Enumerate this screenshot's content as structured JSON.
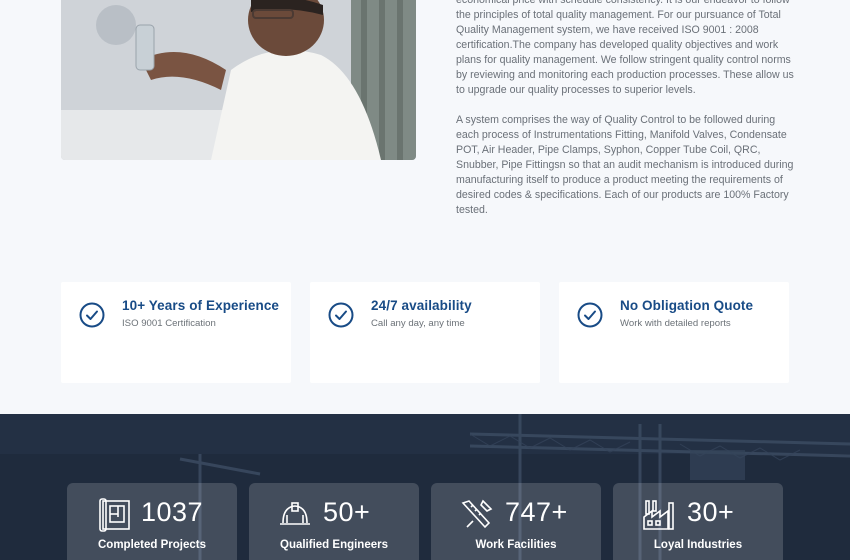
{
  "intro": {
    "paragraph1": "economical price with schedule consistency. It is our endeavor to follow the principles of total quality management. For our pursuance of Total Quality Management system, we have received ISO 9001 : 2008 certification.The company has developed quality objectives and work plans for quality management. We follow stringent quality control norms by reviewing and monitoring each production processes. These allow us to upgrade our quality processes to superior levels.",
    "paragraph2": "A system comprises the way of Quality Control to be followed during each process of Instrumentations Fitting, Manifold Valves, Condensate POT, Air Header, Pipe Clamps, Syphon, Copper Tube Coil, QRC, Snubber, Pipe Fittingsn so that an audit mechanism is introduced during manufacturing itself to produce a product meeting the requirements of desired codes & specifications. Each of our products are 100% Factory tested."
  },
  "features": [
    {
      "title": "10+ Years of Experience",
      "subtitle": "ISO 9001 Certification",
      "icon": "check-circle-icon"
    },
    {
      "title": "24/7 availability",
      "subtitle": "Call any day, any time",
      "icon": "check-circle-icon"
    },
    {
      "title": "No Obligation Quote",
      "subtitle": "Work with detailed reports",
      "icon": "check-circle-icon"
    }
  ],
  "stats": [
    {
      "value": "1037",
      "label": "Completed Projects",
      "icon": "blueprint-icon"
    },
    {
      "value": "50+",
      "label": "Qualified Engineers",
      "icon": "hard-hat-icon"
    },
    {
      "value": "747+",
      "label": "Work Facilities",
      "icon": "tools-icon"
    },
    {
      "value": "30+",
      "label": "Loyal Industries",
      "icon": "factory-icon"
    }
  ],
  "colors": {
    "accent": "#184b86",
    "band": "#1e2a3c",
    "page": "#f6f8fb"
  }
}
